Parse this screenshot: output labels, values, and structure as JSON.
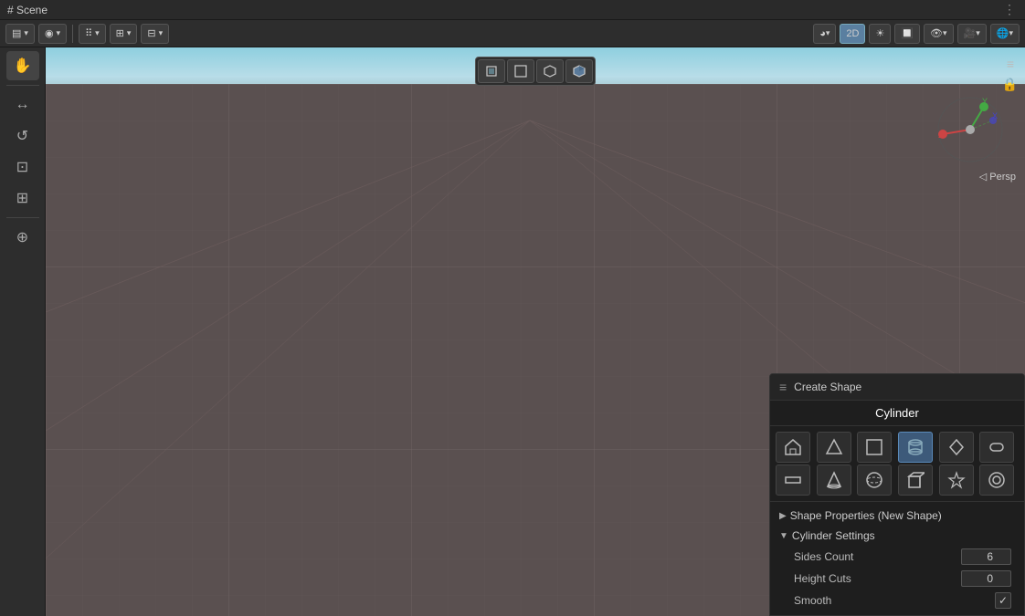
{
  "topbar": {
    "title": "# Scene",
    "dots": "⋮"
  },
  "toolbar": {
    "draw_mode_label": "▤",
    "overlay_label": "◉",
    "btn_2d": "2D",
    "gizmo_label": "☀",
    "snap_label": "🔲",
    "view_label": "👁",
    "camera_label": "🎥",
    "global_label": "🌐"
  },
  "sidebar": {
    "tools": [
      "✋",
      "↔",
      "↺",
      "⊡",
      "⊞",
      "⊕"
    ]
  },
  "viewport": {
    "header_buttons": [
      {
        "label": "⬡",
        "id": "perspective",
        "active": false
      },
      {
        "label": "⊞",
        "id": "orthographic",
        "active": false
      },
      {
        "label": "◧",
        "id": "side",
        "active": false
      },
      {
        "label": "⬒",
        "id": "top",
        "active": false
      }
    ],
    "persp_label": "◁ Persp",
    "nav_gizmo_x": "z",
    "lock_icon": "🔒"
  },
  "create_shape_panel": {
    "header_dots": "≡",
    "header_title": "Create Shape",
    "title": "Cylinder",
    "shapes_row1": [
      {
        "id": "house",
        "icon": "⌂",
        "active": false
      },
      {
        "id": "triangle",
        "icon": "△",
        "active": false
      },
      {
        "id": "square",
        "icon": "□",
        "active": false
      },
      {
        "id": "cylinder",
        "icon": "⬡",
        "active": true
      },
      {
        "id": "prism",
        "icon": "◇",
        "active": false
      },
      {
        "id": "capsule",
        "icon": "⬭",
        "active": false
      }
    ],
    "shapes_row2": [
      {
        "id": "plane",
        "icon": "▭",
        "active": false
      },
      {
        "id": "cone",
        "icon": "▽",
        "active": false
      },
      {
        "id": "sphere",
        "icon": "◎",
        "active": false
      },
      {
        "id": "box",
        "icon": "◻",
        "active": false
      },
      {
        "id": "star",
        "icon": "✦",
        "active": false
      },
      {
        "id": "torus",
        "icon": "⊙",
        "active": false
      }
    ],
    "sections": [
      {
        "id": "shape-properties",
        "label": "Shape Properties (New Shape)",
        "collapsed": true,
        "triangle": "▶"
      },
      {
        "id": "cylinder-settings",
        "label": "Cylinder Settings",
        "collapsed": false,
        "triangle": "▼"
      }
    ],
    "fields": [
      {
        "id": "sides-count",
        "label": "Sides Count",
        "value": "6",
        "type": "number"
      },
      {
        "id": "height-cuts",
        "label": "Height Cuts",
        "value": "0",
        "type": "number"
      },
      {
        "id": "smooth",
        "label": "Smooth",
        "value": "✓",
        "type": "checkbox"
      }
    ]
  }
}
